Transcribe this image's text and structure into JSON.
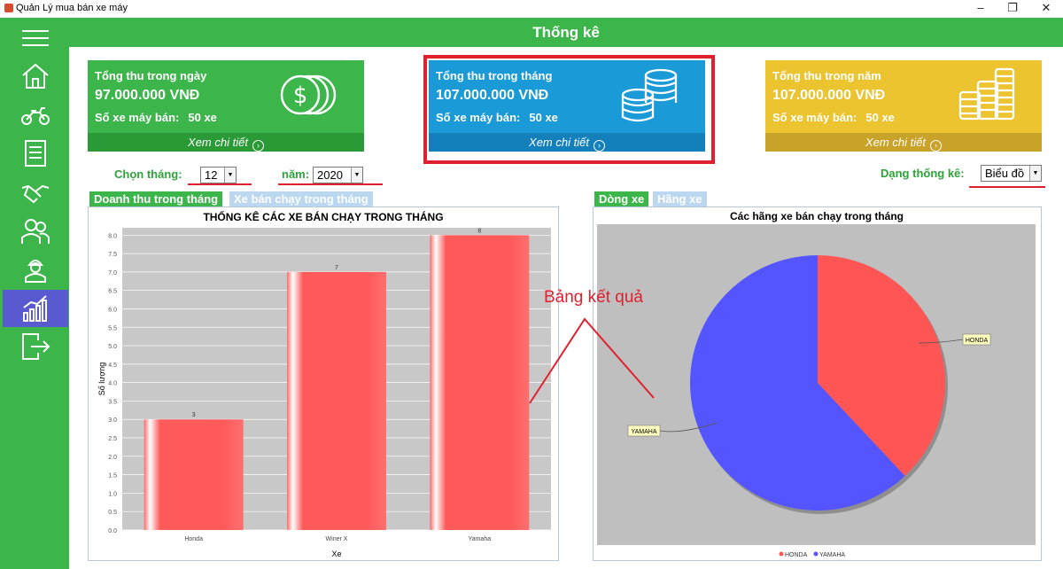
{
  "window": {
    "title": "Quản Lý mua bán xe máy",
    "minimize": "–",
    "maximize": "❐",
    "close": "✕"
  },
  "header": {
    "title": "Thống kê"
  },
  "sidebar": {
    "items": [
      {
        "icon": "menu-icon"
      },
      {
        "icon": "home-icon"
      },
      {
        "icon": "motorbike-icon"
      },
      {
        "icon": "invoice-icon"
      },
      {
        "icon": "handshake-icon"
      },
      {
        "icon": "users-icon"
      },
      {
        "icon": "worker-icon"
      },
      {
        "icon": "chart-icon",
        "active": true
      },
      {
        "icon": "logout-icon"
      }
    ]
  },
  "cards": {
    "day": {
      "title": "Tổng thu trong ngày",
      "amount": "97.000.000 VNĐ",
      "sold_label": "Số xe máy bán:",
      "sold_value": "50 xe",
      "link": "Xem chi tiết",
      "color": "#3cb54a",
      "foot_color": "#2a9a37"
    },
    "month": {
      "title": "Tổng thu trong tháng",
      "amount": "107.000.000 VNĐ",
      "sold_label": "Số xe máy bán:",
      "sold_value": "50 xe",
      "link": "Xem chi tiết",
      "color": "#1a9ad6",
      "foot_color": "#1480bb"
    },
    "year": {
      "title": "Tổng thu trong năm",
      "amount": "107.000.000 VNĐ",
      "sold_label": "Số xe máy bán:",
      "sold_value": "50 xe",
      "link": "Xem chi tiết",
      "color": "#ecc430",
      "foot_color": "#c9a22a"
    }
  },
  "filters": {
    "month_label": "Chọn tháng:",
    "month_value": "12",
    "year_label": "năm:",
    "year_value": "2020",
    "type_label": "Dạng thống kê:",
    "type_value": "Biểu đồ"
  },
  "left_tabs": [
    "Doanh thu trong tháng",
    "Xe bán chạy trong tháng"
  ],
  "right_tabs": [
    "Dòng xe",
    "Hãng xe"
  ],
  "annotation": "Bảng kết quả",
  "chart_data": [
    {
      "type": "bar",
      "title": "THỐNG KÊ CÁC XE BÁN CHẠY TRONG THÁNG",
      "xlabel": "Xe",
      "ylabel": "Số lượng",
      "categories": [
        "Honda",
        "Winer X",
        "Yamaha"
      ],
      "values": [
        3,
        7,
        8
      ],
      "ylim": [
        0,
        8.2
      ],
      "yticks": [
        "0.0",
        "0.5",
        "1.0",
        "1.5",
        "2.0",
        "2.5",
        "3.0",
        "3.5",
        "4.0",
        "4.5",
        "5.0",
        "5.5",
        "6.0",
        "6.5",
        "7.0",
        "7.5",
        "8.0"
      ],
      "grid": true,
      "color": "#ff5a5a"
    },
    {
      "type": "pie",
      "title": "Các hãng xe bán chạy trong tháng",
      "labels": [
        "HONDA",
        "YAMAHA"
      ],
      "values": [
        38,
        62
      ],
      "colors": [
        "#ff5555",
        "#5555ff"
      ],
      "legend": "bottom"
    }
  ]
}
